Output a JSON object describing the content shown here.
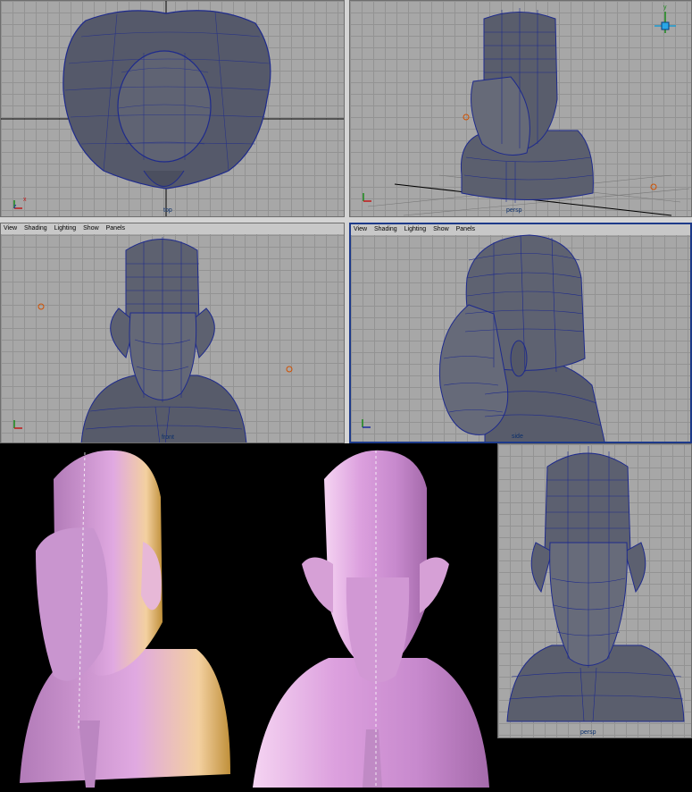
{
  "viewport_menu": [
    "View",
    "Shading",
    "Lighting",
    "Show",
    "Panels"
  ],
  "viewports": {
    "top": {
      "label": "top"
    },
    "persp": {
      "label": "persp"
    },
    "front": {
      "label": "front"
    },
    "side": {
      "label": "side"
    },
    "extra": {
      "label": "persp"
    }
  },
  "axis_labels": {
    "x": "x",
    "y": "y",
    "z": "z"
  },
  "colors": {
    "viewport_bg": "#a7a7a7",
    "grid": "#939393",
    "mesh": "#4a4e5a",
    "wire": "#1e2a8c",
    "render_skin": "#d9a3dc",
    "active_border": "#1d3a8a"
  }
}
